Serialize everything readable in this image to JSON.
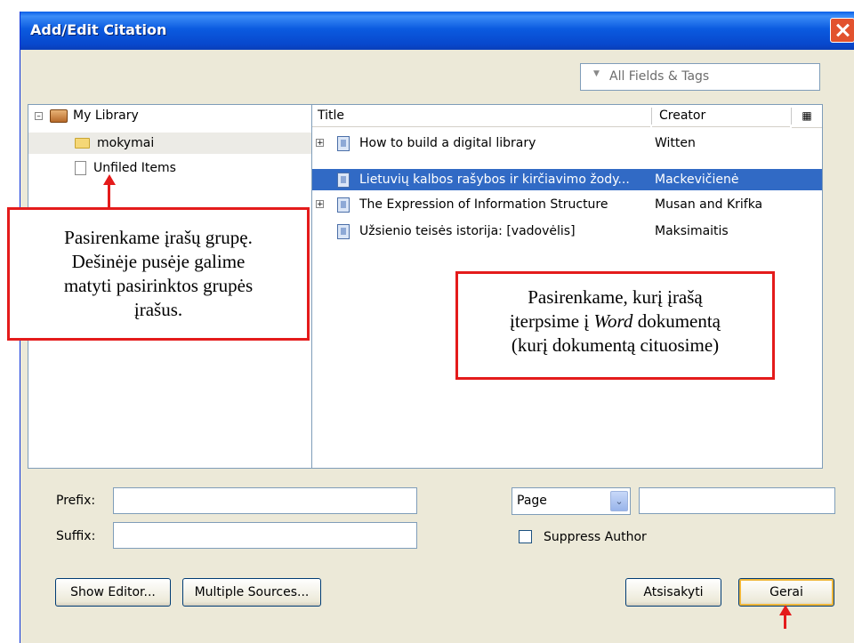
{
  "window": {
    "title": "Add/Edit Citation"
  },
  "search": {
    "placeholder": "All Fields & Tags"
  },
  "tree": {
    "library": "My Library",
    "items": [
      {
        "label": "mokymai",
        "selected": true
      },
      {
        "label": "Unfiled Items",
        "selected": false
      }
    ]
  },
  "table": {
    "headers": {
      "title": "Title",
      "creator": "Creator"
    },
    "rows": [
      {
        "title": "How to build a digital library",
        "creator": "Witten",
        "expandable": true,
        "selected": false
      },
      {
        "title": "Lietuvių kalbos rašybos ir kirčiavimo žody...",
        "creator": "Mackevičienė",
        "expandable": false,
        "selected": true
      },
      {
        "title": "The Expression of Information Structure",
        "creator": "Musan and Krifka",
        "expandable": true,
        "selected": false
      },
      {
        "title": "Užsienio teisės istorija: [vadovėlis]",
        "creator": "Maksimaitis",
        "expandable": false,
        "selected": false
      }
    ]
  },
  "form": {
    "prefix_label": "Prefix:",
    "suffix_label": "Suffix:",
    "prefix_value": "",
    "suffix_value": "",
    "locator_selected": "Page",
    "locator_value": "",
    "suppress_author_label": "Suppress Author",
    "suppress_author_checked": false
  },
  "buttons": {
    "show_editor": "Show Editor...",
    "multiple_sources": "Multiple Sources...",
    "cancel": "Atsisakyti",
    "ok": "Gerai"
  },
  "annotations": {
    "left_callout": [
      "Pasirenkame įrašų grupę.",
      "Dešinėje pusėje galime",
      "matyti pasirinktos grupės",
      "įrašus."
    ],
    "right_callout_line1": "Pasirenkame, kurį įrašą",
    "right_callout_line2_pre": "įterpsime į ",
    "right_callout_line2_em": "Word",
    "right_callout_line2_post": " dokumentą",
    "right_callout_line3": "(kurį dokumentą cituosime)"
  },
  "colors": {
    "selection": "#316ac5",
    "annotation": "#e41b1b",
    "titlebar": "#0a5fe8"
  }
}
